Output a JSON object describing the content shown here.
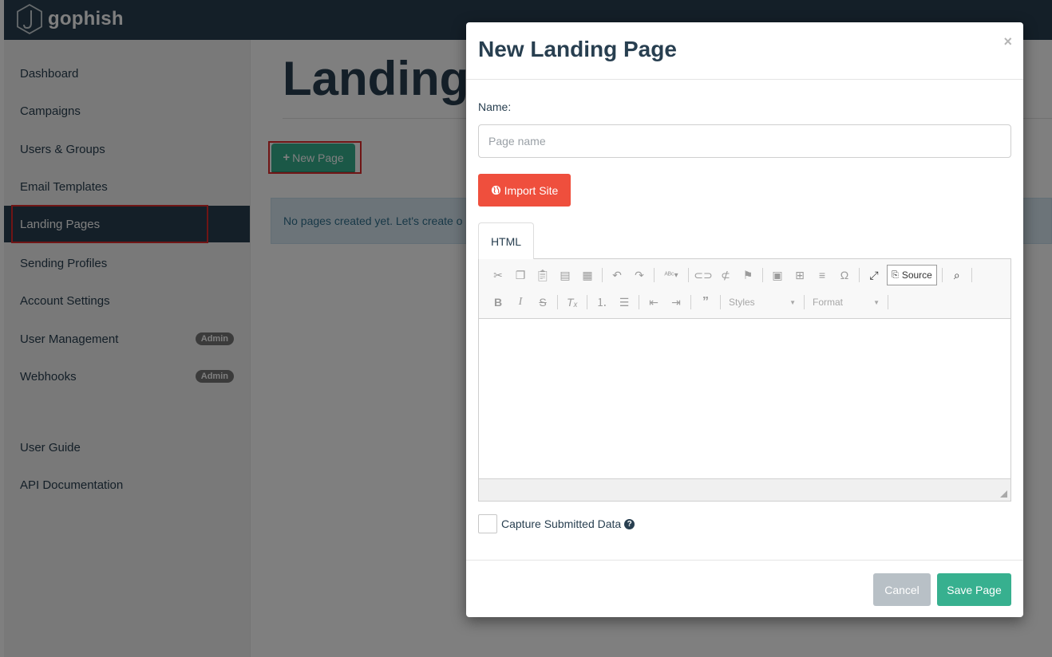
{
  "app": {
    "brand": "gophish"
  },
  "sidebar": {
    "items": [
      {
        "label": "Dashboard"
      },
      {
        "label": "Campaigns"
      },
      {
        "label": "Users & Groups"
      },
      {
        "label": "Email Templates"
      },
      {
        "label": "Landing Pages",
        "active": true
      },
      {
        "label": "Sending Profiles"
      },
      {
        "label": "Account Settings"
      },
      {
        "label": "User Management",
        "badge": "Admin"
      },
      {
        "label": "Webhooks",
        "badge": "Admin"
      },
      {
        "label": "User Guide"
      },
      {
        "label": "API Documentation"
      }
    ]
  },
  "main": {
    "title": "Landing",
    "new_page_label": "New Page",
    "empty_message": "No pages created yet. Let's create o"
  },
  "modal": {
    "title": "New Landing Page",
    "close_label": "×",
    "name_label": "Name:",
    "name_placeholder": "Page name",
    "name_value": "",
    "import_label": "Import Site",
    "tab_label": "HTML",
    "toolbar": {
      "row1": [
        "cut-icon",
        "copy-icon",
        "paste-icon",
        "paste-text-icon",
        "paste-word-icon",
        "undo-icon",
        "redo-icon",
        "spellcheck-icon",
        "link-icon",
        "unlink-icon",
        "anchor-icon",
        "image-icon",
        "table-icon",
        "horizontal-line-icon",
        "special-char-icon",
        "maximize-icon",
        "source-icon",
        "preview-icon"
      ],
      "row2": [
        "bold-icon",
        "italic-icon",
        "strike-icon",
        "remove-format-icon",
        "numbered-list-icon",
        "bulleted-list-icon",
        "outdent-icon",
        "indent-icon",
        "blockquote-icon"
      ],
      "source_label": "Source",
      "styles_label": "Styles",
      "format_label": "Format"
    },
    "capture_label": "Capture Submitted Data",
    "capture_checked": false,
    "cancel_label": "Cancel",
    "save_label": "Save Page"
  },
  "colors": {
    "navbar": "#283f50",
    "accent_green": "#37b08f",
    "import_red": "#ef4f3d",
    "highlight_red": "#e02a2a"
  }
}
